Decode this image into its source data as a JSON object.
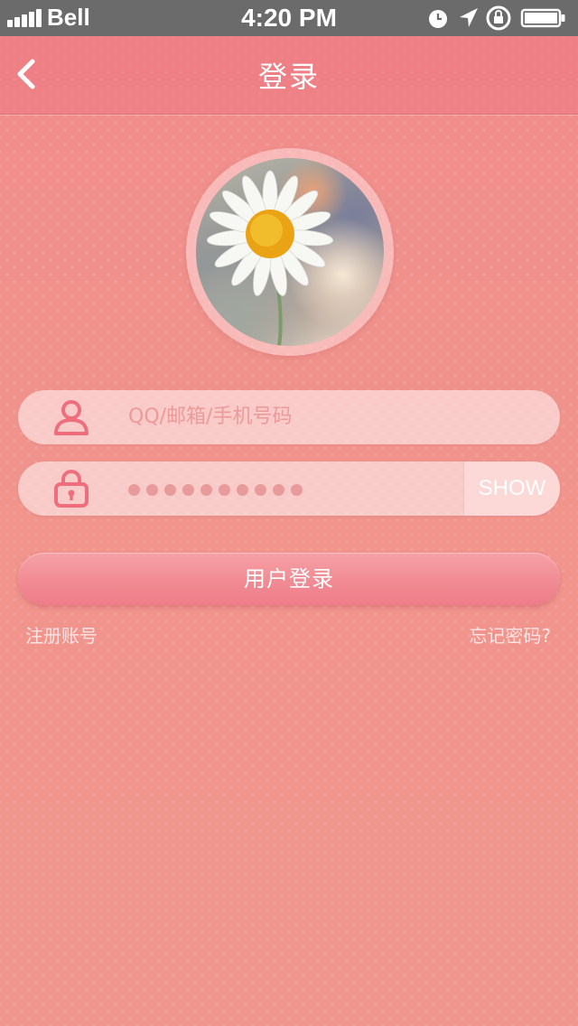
{
  "statusbar": {
    "carrier": "Bell",
    "time": "4:20 PM"
  },
  "nav": {
    "title": "登录",
    "back_icon": "chevron-left-icon"
  },
  "avatar": {
    "description_icon": "user-avatar"
  },
  "form": {
    "username_placeholder": "QQ/邮箱/手机号码",
    "password_masked_length": 10,
    "show_label": "SHOW",
    "login_label": "用户登录"
  },
  "links": {
    "register": "注册账号",
    "forgot": "忘记密码?"
  },
  "colors": {
    "background": "#ee938d",
    "accent": "#f0727f",
    "button": "#f18b93",
    "statusbar": "#6b6b6b"
  }
}
